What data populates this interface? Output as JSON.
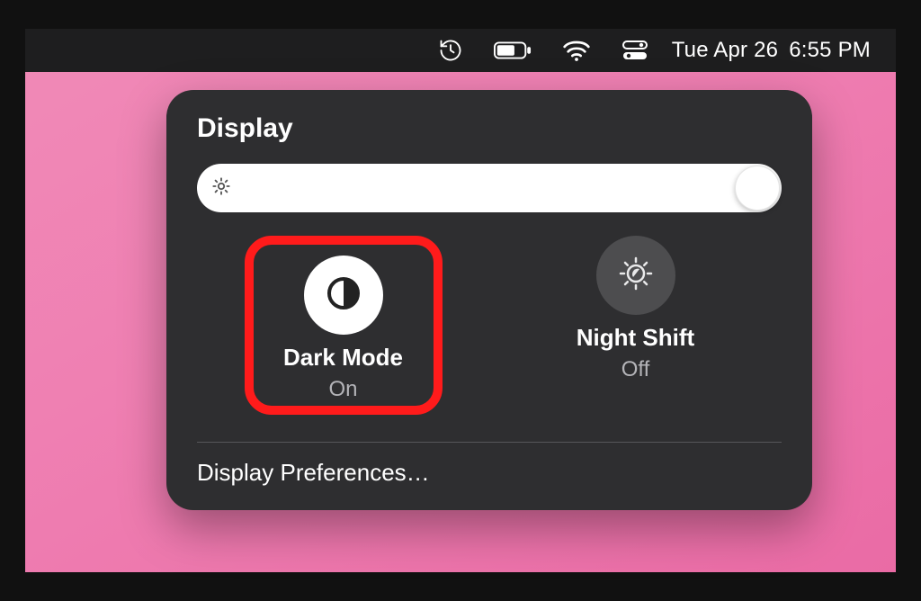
{
  "menubar": {
    "date": "Tue Apr 26",
    "time": "6:55 PM"
  },
  "panel": {
    "title": "Display",
    "brightness_value": 100,
    "modes": [
      {
        "id": "dark-mode",
        "label": "Dark Mode",
        "status": "On",
        "active": true
      },
      {
        "id": "night-shift",
        "label": "Night Shift",
        "status": "Off",
        "active": false
      }
    ],
    "preferences_link": "Display Preferences…"
  },
  "annotation": {
    "highlighted_control": "dark-mode-toggle",
    "highlight_color": "#ff1b1b"
  },
  "colors": {
    "menubar_bg": "#1e1e1f",
    "panel_bg": "#2e2e30",
    "desktop_gradient_start": "#f08ab7",
    "desktop_gradient_end": "#ea6ba5"
  }
}
